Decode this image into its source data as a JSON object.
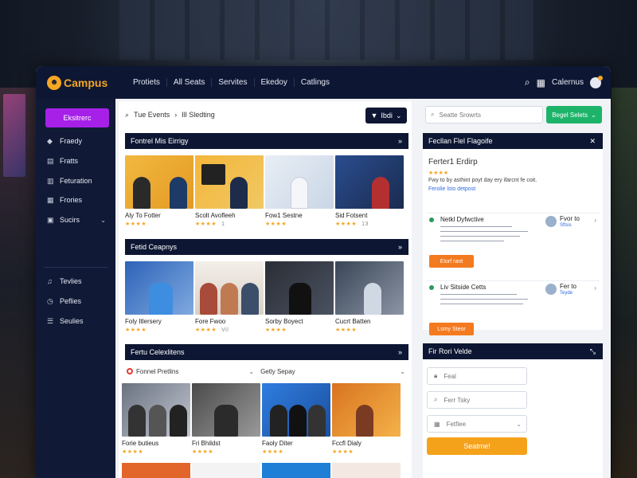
{
  "app": {
    "logo_text": "Campus",
    "nav": [
      "Protiets",
      "All Seats",
      "Servites",
      "Ekedoy",
      "Catlings"
    ],
    "top_right_label": "Calernus"
  },
  "sidebar": {
    "primary_button": "Eksitrerc",
    "items": [
      {
        "label": "Fraedy",
        "icon": "tag-icon"
      },
      {
        "label": "Fratts",
        "icon": "file-icon"
      },
      {
        "label": "Feturation",
        "icon": "book-icon"
      },
      {
        "label": "Frories",
        "icon": "calendar-icon"
      },
      {
        "label": "Sucirs",
        "icon": "group-icon"
      },
      {
        "label": "Tevlies",
        "icon": "music-icon"
      },
      {
        "label": "Peflies",
        "icon": "clock-icon"
      },
      {
        "label": "Seulies",
        "icon": "list-icon"
      }
    ]
  },
  "main": {
    "breadcrumb": {
      "first": "Tue Events",
      "separator": "›",
      "second": "Ill Sledting"
    },
    "filter_button": "Ibdi",
    "sections": [
      {
        "title": "Fontrel Mis Eirrigy",
        "cards": [
          {
            "title": "Aly To Fotter",
            "stars": "★★★★",
            "count": ""
          },
          {
            "title": "Scolt Avofleeh",
            "stars": "★★★★",
            "count": "1"
          },
          {
            "title": "Fow1 Sestne",
            "stars": "★★★★",
            "count": ""
          },
          {
            "title": "Sid Fotsent",
            "stars": "★★★★",
            "count": "13"
          }
        ]
      },
      {
        "title": "Fetid Ceapnys",
        "cards": [
          {
            "title": "Foly Itlersery",
            "stars": "★★★★",
            "count": ""
          },
          {
            "title": "Fore Fwoo",
            "stars": "★★★★",
            "count": "Vil"
          },
          {
            "title": "Sorby Boyect",
            "stars": "★★★★",
            "count": ""
          },
          {
            "title": "Cucrt Batten",
            "stars": "★★★★",
            "count": ""
          }
        ]
      },
      {
        "title": "Fertu Celexlitens",
        "cards": [
          {
            "title": "Forie butieus",
            "stars": "★★★★",
            "count": ""
          },
          {
            "title": "Fri Bhildst",
            "stars": "★★★★",
            "count": ""
          },
          {
            "title": "Faoly Diter",
            "stars": "★★★★",
            "count": ""
          },
          {
            "title": "Fccfl Dialy",
            "stars": "★★★★",
            "count": ""
          }
        ]
      }
    ],
    "subfilter_left": "Fonnel Pretlins",
    "subfilter_right": "Getly Sepay"
  },
  "right": {
    "search_placeholder": "Seatte Srowrts",
    "green_button": "Begel Selets",
    "panel1": {
      "title": "Fecllan Flel Flagoife",
      "feature_title": "Ferter1 Erdirp",
      "feature_stars": "★★★★",
      "feature_desc": "Fwy to by asthint poyt day ery ifarcnt fe coit.",
      "feature_link": "Ferolie lsto detpost",
      "events": [
        {
          "title": "Netkl Dyfwctive",
          "side": "Fvor to",
          "side2": "Sftsis",
          "button": "Eiorf rant"
        },
        {
          "title": "Liv Sitside Cetts",
          "side": "Fer to",
          "side2": "Teyde",
          "button": "Lsmy Steor"
        }
      ]
    },
    "panel2": {
      "title": "Fir Rori Velde",
      "fields": [
        {
          "placeholder": "Feal",
          "icon": "lock-icon"
        },
        {
          "placeholder": "Ferr Tsky",
          "icon": "search-icon"
        },
        {
          "placeholder": "Fetfiee",
          "icon": "calendar-icon"
        }
      ],
      "submit": "Seatme!"
    }
  }
}
